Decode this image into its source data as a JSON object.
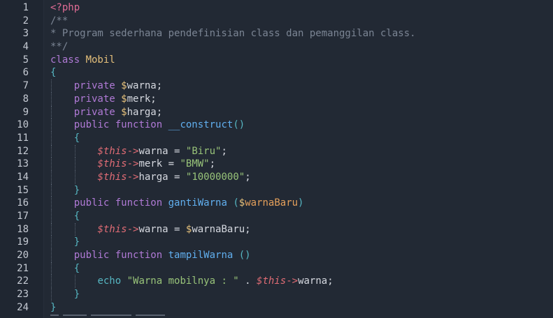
{
  "editor": {
    "line_numbers": [
      "1",
      "2",
      "3",
      "4",
      "5",
      "6",
      "7",
      "8",
      "9",
      "10",
      "11",
      "12",
      "13",
      "14",
      "15",
      "16",
      "17",
      "18",
      "19",
      "20",
      "21",
      "22",
      "23",
      "24"
    ],
    "lines": [
      [
        [
          "t-tag",
          "<?php"
        ]
      ],
      [
        [
          "t-com",
          "/**"
        ]
      ],
      [
        [
          "t-com",
          "* Program sederhana pendefinisian class dan pemanggilan class."
        ]
      ],
      [
        [
          "t-com",
          "**/"
        ]
      ],
      [
        [
          "t-kwp",
          "class "
        ],
        [
          "t-cls",
          "Mobil"
        ]
      ],
      [
        [
          "t-punc",
          "{"
        ]
      ],
      [
        [
          "t-plain",
          "    "
        ],
        [
          "t-kwp",
          "private "
        ],
        [
          "t-dol",
          "$"
        ],
        [
          "t-var",
          "warna;"
        ]
      ],
      [
        [
          "t-plain",
          "    "
        ],
        [
          "t-kwp",
          "private "
        ],
        [
          "t-dol",
          "$"
        ],
        [
          "t-var",
          "merk;"
        ]
      ],
      [
        [
          "t-plain",
          "    "
        ],
        [
          "t-kwp",
          "private "
        ],
        [
          "t-dol",
          "$"
        ],
        [
          "t-var",
          "harga;"
        ]
      ],
      [
        [
          "t-plain",
          "    "
        ],
        [
          "t-kwp",
          "public "
        ],
        [
          "t-kwp",
          "function "
        ],
        [
          "t-fn",
          "__construct"
        ],
        [
          "t-punc",
          "()"
        ]
      ],
      [
        [
          "t-plain",
          "    "
        ],
        [
          "t-punc",
          "{"
        ]
      ],
      [
        [
          "t-plain",
          "        "
        ],
        [
          "t-this",
          "$this"
        ],
        [
          "t-op",
          "->"
        ],
        [
          "t-prop",
          "warna = "
        ],
        [
          "t-str",
          "\"Biru\""
        ],
        [
          "t-plain",
          ";"
        ]
      ],
      [
        [
          "t-plain",
          "        "
        ],
        [
          "t-this",
          "$this"
        ],
        [
          "t-op",
          "->"
        ],
        [
          "t-prop",
          "merk = "
        ],
        [
          "t-str",
          "\"BMW\""
        ],
        [
          "t-plain",
          ";"
        ]
      ],
      [
        [
          "t-plain",
          "        "
        ],
        [
          "t-this",
          "$this"
        ],
        [
          "t-op",
          "->"
        ],
        [
          "t-prop",
          "harga = "
        ],
        [
          "t-str",
          "\"10000000\""
        ],
        [
          "t-plain",
          ";"
        ]
      ],
      [
        [
          "t-plain",
          "    "
        ],
        [
          "t-punc",
          "}"
        ]
      ],
      [
        [
          "t-plain",
          "    "
        ],
        [
          "t-kwp",
          "public "
        ],
        [
          "t-kwp",
          "function "
        ],
        [
          "t-fn",
          "gantiWarna "
        ],
        [
          "t-punc",
          "("
        ],
        [
          "t-dol",
          "$"
        ],
        [
          "t-param",
          "warnaBaru"
        ],
        [
          "t-punc",
          ")"
        ]
      ],
      [
        [
          "t-plain",
          "    "
        ],
        [
          "t-punc",
          "{"
        ]
      ],
      [
        [
          "t-plain",
          "        "
        ],
        [
          "t-this",
          "$this"
        ],
        [
          "t-op",
          "->"
        ],
        [
          "t-prop",
          "warna = "
        ],
        [
          "t-dol",
          "$"
        ],
        [
          "t-var",
          "warnaBaru;"
        ]
      ],
      [
        [
          "t-plain",
          "    "
        ],
        [
          "t-punc",
          "}"
        ]
      ],
      [
        [
          "t-plain",
          "    "
        ],
        [
          "t-kwp",
          "public "
        ],
        [
          "t-kwp",
          "function "
        ],
        [
          "t-fn",
          "tampilWarna "
        ],
        [
          "t-punc",
          "()"
        ]
      ],
      [
        [
          "t-plain",
          "    "
        ],
        [
          "t-punc",
          "{"
        ]
      ],
      [
        [
          "t-plain",
          "        "
        ],
        [
          "t-echo",
          "echo "
        ],
        [
          "t-str",
          "\"Warna mobilnya : \""
        ],
        [
          "t-plain",
          " . "
        ],
        [
          "t-this",
          "$this"
        ],
        [
          "t-op",
          "->"
        ],
        [
          "t-prop",
          "warna;"
        ]
      ],
      [
        [
          "t-plain",
          "    "
        ],
        [
          "t-punc",
          "}"
        ]
      ],
      [
        [
          "t-punc",
          "}"
        ]
      ]
    ]
  },
  "colors": {
    "background": "#222934",
    "gutter": "#1f2631",
    "line_number": "#c5cad3",
    "comment": "#7b8594",
    "keyword": "#b07ad6",
    "class_name": "#e5c07b",
    "function_name": "#61afef",
    "string": "#98c379",
    "this": "#e06c75",
    "punctuation": "#56b6c2"
  }
}
